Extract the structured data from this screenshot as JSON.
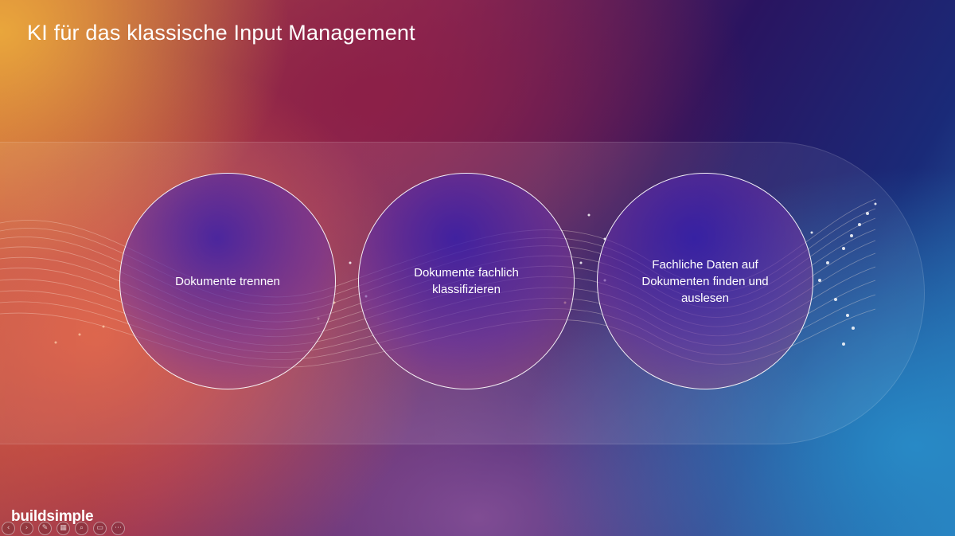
{
  "slide": {
    "title": "KI für das klassische Input Management"
  },
  "steps": [
    {
      "label": "Dokumente trennen"
    },
    {
      "label": "Dokumente fachlich klassifizieren"
    },
    {
      "label": "Fachliche Daten auf Dokumenten finden und auslesen"
    }
  ],
  "brand": {
    "logo_text": "buildsimple"
  },
  "toolbar": {
    "icons": [
      "prev-icon",
      "next-icon",
      "pen-icon",
      "slides-icon",
      "zoom-icon",
      "subtitles-icon",
      "more-icon"
    ]
  },
  "colors": {
    "title_text": "#ffffff",
    "circle_border": "#ffffff"
  }
}
